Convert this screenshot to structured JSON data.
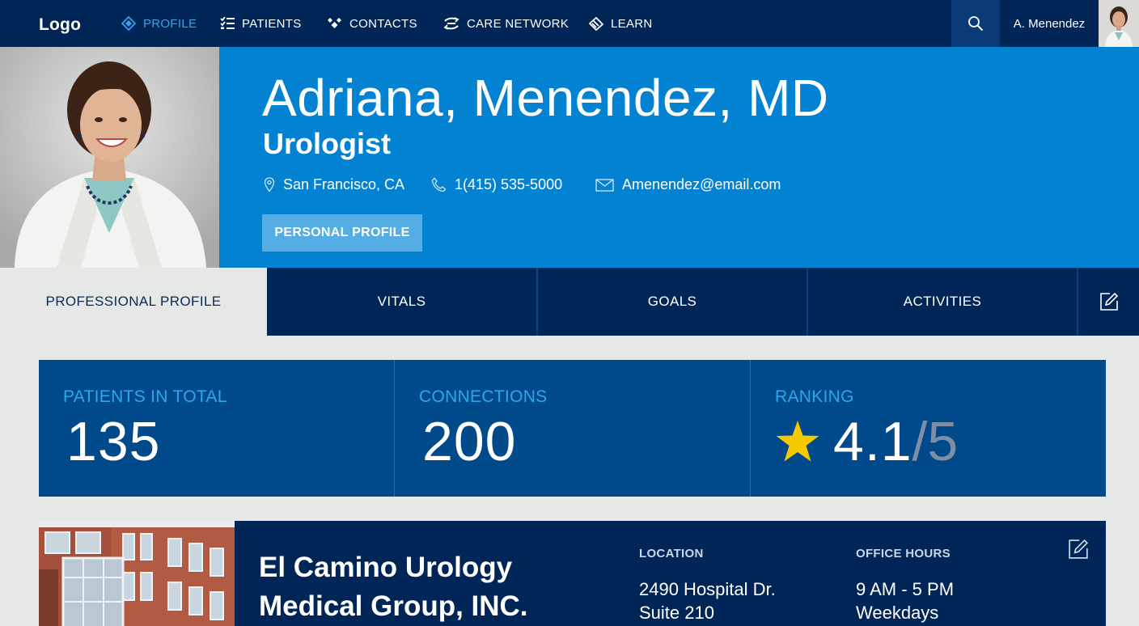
{
  "nav": {
    "logo": "Logo",
    "items": [
      {
        "label": "PROFILE",
        "active": true
      },
      {
        "label": "PATIENTS"
      },
      {
        "label": "CONTACTS"
      },
      {
        "label": "CARE NETWORK"
      },
      {
        "label": "LEARN"
      }
    ],
    "user_name": "A. Menendez"
  },
  "header": {
    "name": "Adriana, Menendez, MD",
    "specialty": "Urologist",
    "location": "San Francisco, CA",
    "phone": "1(415) 535-5000",
    "email": "Amenendez@email.com",
    "profile_button": "PERSONAL PROFILE"
  },
  "tabs": [
    {
      "label": "PROFESSIONAL PROFILE",
      "active": true
    },
    {
      "label": "VITALS"
    },
    {
      "label": "GOALS"
    },
    {
      "label": "ACTIVITIES"
    }
  ],
  "stats": {
    "patients": {
      "label": "PATIENTS IN TOTAL",
      "value": "135"
    },
    "connections": {
      "label": "CONNECTIONS",
      "value": "200"
    },
    "ranking": {
      "label": "RANKING",
      "value": "4.1",
      "max": "/5",
      "rating": 4.1,
      "out_of": 5
    }
  },
  "office": {
    "name_line1": "El Camino Urology",
    "name_line2": "Medical Group, INC.",
    "location_label": "LOCATION",
    "location_line1": "2490 Hospital Dr.",
    "location_line2": "Suite 210",
    "hours_label": "OFFICE HOURS",
    "hours_line1": "9 AM - 5 PM",
    "hours_line2": "Weekdays"
  },
  "colors": {
    "nav_bg": "#002658",
    "hero_bg": "#0482d2",
    "accent": "#3aa0e8",
    "stats_bg": "#004a8b",
    "star": "#f5c800"
  }
}
